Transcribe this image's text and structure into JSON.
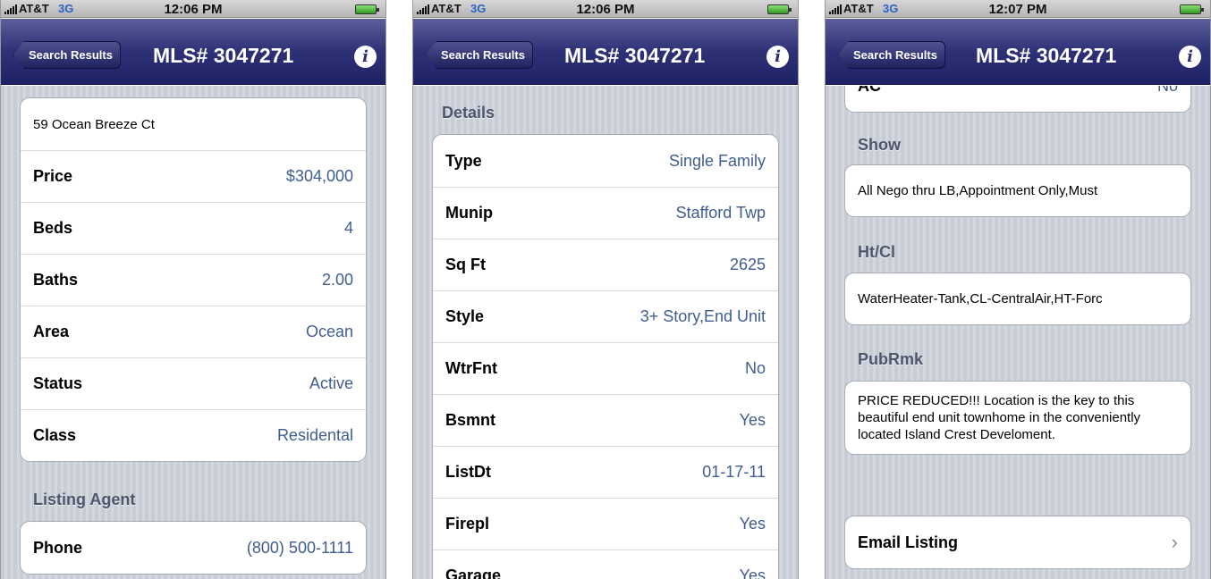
{
  "statusbar": {
    "carrier": "AT&T",
    "network": "3G"
  },
  "screens": [
    {
      "time": "12:06 PM",
      "back_label": "Search Results",
      "title": "MLS# 3047271",
      "address": "59 Ocean Breeze Ct",
      "rows": [
        {
          "label": "Price",
          "value": "$304,000"
        },
        {
          "label": "Beds",
          "value": "4"
        },
        {
          "label": "Baths",
          "value": "2.00"
        },
        {
          "label": "Area",
          "value": "Ocean"
        },
        {
          "label": "Status",
          "value": "Active"
        },
        {
          "label": "Class",
          "value": "Residental"
        }
      ],
      "agent_header": "Listing Agent",
      "agent_row": {
        "label": "Phone",
        "value": "(800) 500-1111"
      }
    },
    {
      "time": "12:06 PM",
      "back_label": "Search Results",
      "title": "MLS# 3047271",
      "section_header": "Details",
      "rows": [
        {
          "label": "Type",
          "value": "Single Family"
        },
        {
          "label": "Munip",
          "value": "Stafford Twp"
        },
        {
          "label": "Sq Ft",
          "value": "2625"
        },
        {
          "label": "Style",
          "value": "3+ Story,End Unit"
        },
        {
          "label": "WtrFnt",
          "value": "No"
        },
        {
          "label": "Bsmnt",
          "value": "Yes"
        },
        {
          "label": "ListDt",
          "value": "01-17-11"
        },
        {
          "label": "Firepl",
          "value": "Yes"
        },
        {
          "label": "Garage",
          "value": "Yes"
        }
      ]
    },
    {
      "time": "12:07 PM",
      "back_label": "Search Results",
      "title": "MLS# 3047271",
      "partial_row": {
        "label": "AC",
        "value": "No"
      },
      "show_header": "Show",
      "show_text": "All Nego thru LB,Appointment Only,Must",
      "htcl_header": "Ht/Cl",
      "htcl_text": "WaterHeater-Tank,CL-CentralAir,HT-Forc",
      "pubrmk_header": "PubRmk",
      "pubrmk_text": "PRICE REDUCED!!! Location is the key to this beautiful end unit townhome in the conveniently located Island Crest Develoment.",
      "email_label": "Email Listing"
    }
  ],
  "icons": {
    "info": "info-icon",
    "signal": "signal-bars-icon",
    "battery": "battery-icon",
    "chevron": "chevron-right-icon"
  },
  "colors": {
    "navbar": "#2e3176",
    "value_text": "#3f5d91",
    "table_background": "#cdd1da"
  }
}
